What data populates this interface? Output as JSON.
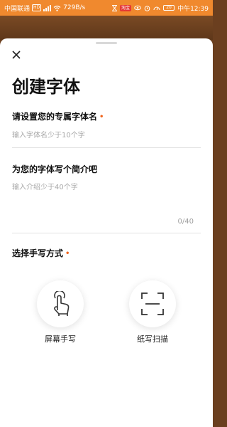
{
  "status_bar": {
    "carrier": "中国联通",
    "sim_badge": "HD",
    "network_speed": "729B/s",
    "app_badge": "淘宝",
    "battery": "20",
    "time": "中午12:39"
  },
  "dialog": {
    "title": "创建字体",
    "name_field": {
      "label": "请设置您的专属字体名",
      "required_mark": "•",
      "placeholder": "输入字体名少于10个字",
      "value": ""
    },
    "intro_field": {
      "label": "为您的字体写个简介吧",
      "placeholder": "输入介绍少于40个字",
      "value": "",
      "counter": "0/40"
    },
    "method_section": {
      "label": "选择手写方式",
      "required_mark": "•",
      "options": [
        {
          "label": "屏幕手写",
          "icon": "hand-touch-icon"
        },
        {
          "label": "纸写扫描",
          "icon": "scan-frame-icon"
        }
      ]
    }
  },
  "colors": {
    "accent": "#f0651e",
    "status_bar": "#f0892e",
    "backdrop": "#6b3f1f"
  }
}
